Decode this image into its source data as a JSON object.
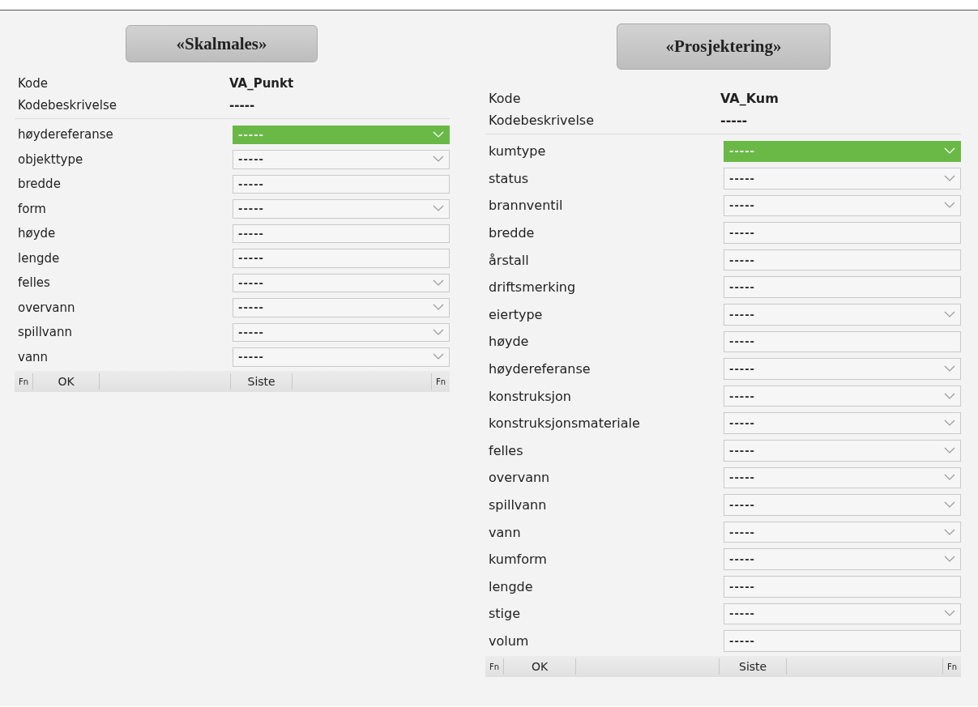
{
  "panels": [
    {
      "title": "«Skalmales»",
      "code_label": "Kode",
      "code": "VA_Punkt",
      "desc_label": "Kodebeskrivelse",
      "desc": "-----",
      "fields": [
        {
          "label": "høydereferanse",
          "kind": "dropdown",
          "value": "-----",
          "highlighted": true
        },
        {
          "label": "objekttype",
          "kind": "dropdown",
          "value": "-----",
          "highlighted": false
        },
        {
          "label": "bredde",
          "kind": "text",
          "value": "-----",
          "highlighted": false
        },
        {
          "label": "form",
          "kind": "dropdown",
          "value": "-----",
          "highlighted": false
        },
        {
          "label": "høyde",
          "kind": "text",
          "value": "-----",
          "highlighted": false
        },
        {
          "label": "lengde",
          "kind": "text",
          "value": "-----",
          "highlighted": false
        },
        {
          "label": "felles",
          "kind": "dropdown",
          "value": "-----",
          "highlighted": false
        },
        {
          "label": "overvann",
          "kind": "dropdown",
          "value": "-----",
          "highlighted": false
        },
        {
          "label": "spillvann",
          "kind": "dropdown",
          "value": "-----",
          "highlighted": false
        },
        {
          "label": "vann",
          "kind": "dropdown",
          "value": "-----",
          "highlighted": false
        }
      ],
      "footer": {
        "fn_left": "Fn",
        "ok": "OK",
        "last": "Siste",
        "fn_right": "Fn"
      }
    },
    {
      "title": "«Prosjektering»",
      "code_label": "Kode",
      "code": "VA_Kum",
      "desc_label": "Kodebeskrivelse",
      "desc": "-----",
      "fields": [
        {
          "label": "kumtype",
          "kind": "dropdown",
          "value": "-----",
          "highlighted": true
        },
        {
          "label": "status",
          "kind": "dropdown",
          "value": "-----",
          "highlighted": false
        },
        {
          "label": "brannventil",
          "kind": "dropdown",
          "value": "-----",
          "highlighted": false
        },
        {
          "label": "bredde",
          "kind": "text",
          "value": "-----",
          "highlighted": false
        },
        {
          "label": "årstall",
          "kind": "text",
          "value": "-----",
          "highlighted": false
        },
        {
          "label": "driftsmerking",
          "kind": "text",
          "value": "-----",
          "highlighted": false
        },
        {
          "label": "eiertype",
          "kind": "dropdown",
          "value": "-----",
          "highlighted": false
        },
        {
          "label": "høyde",
          "kind": "text",
          "value": "-----",
          "highlighted": false
        },
        {
          "label": "høydereferanse",
          "kind": "dropdown",
          "value": "-----",
          "highlighted": false
        },
        {
          "label": "konstruksjon",
          "kind": "dropdown",
          "value": "-----",
          "highlighted": false
        },
        {
          "label": "konstruksjonsmateriale",
          "kind": "dropdown",
          "value": "-----",
          "highlighted": false
        },
        {
          "label": "felles",
          "kind": "dropdown",
          "value": "-----",
          "highlighted": false
        },
        {
          "label": "overvann",
          "kind": "dropdown",
          "value": "-----",
          "highlighted": false
        },
        {
          "label": "spillvann",
          "kind": "dropdown",
          "value": "-----",
          "highlighted": false
        },
        {
          "label": "vann",
          "kind": "dropdown",
          "value": "-----",
          "highlighted": false
        },
        {
          "label": "kumform",
          "kind": "dropdown",
          "value": "-----",
          "highlighted": false
        },
        {
          "label": "lengde",
          "kind": "text",
          "value": "-----",
          "highlighted": false
        },
        {
          "label": "stige",
          "kind": "dropdown",
          "value": "-----",
          "highlighted": false
        },
        {
          "label": "volum",
          "kind": "text",
          "value": "-----",
          "highlighted": false
        }
      ],
      "footer": {
        "fn_left": "Fn",
        "ok": "OK",
        "last": "Siste",
        "fn_right": "Fn"
      }
    }
  ]
}
